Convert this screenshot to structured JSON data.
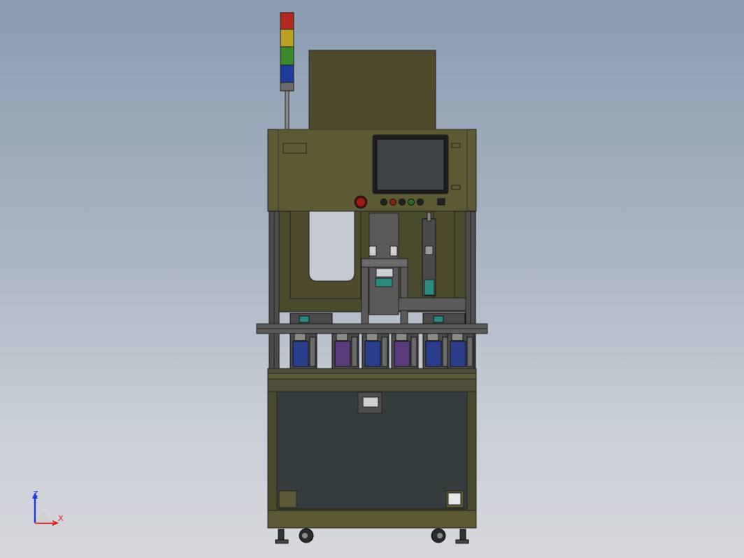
{
  "viewport": {
    "background_top": "#8a9bb0",
    "background_bottom": "#d6d8dc"
  },
  "model": {
    "name": "automatic-assembly-machine",
    "frame_color": "#5a5a30",
    "panel_color": "#4f4a2e",
    "enclosure_color": "#353c3e",
    "screen_color": "#3e4347",
    "tower_light_colors": [
      "#b02a20",
      "#b8a020",
      "#3a8a2a",
      "#1e3a9c"
    ],
    "cylinder_color": "#2b3e8c",
    "accent_teal": "#2a8a80",
    "accent_purple": "#5a3a7a"
  },
  "triad": {
    "z_label": "Z",
    "x_label": "X",
    "z_color": "#1e3ae0",
    "x_color": "#e02020"
  }
}
